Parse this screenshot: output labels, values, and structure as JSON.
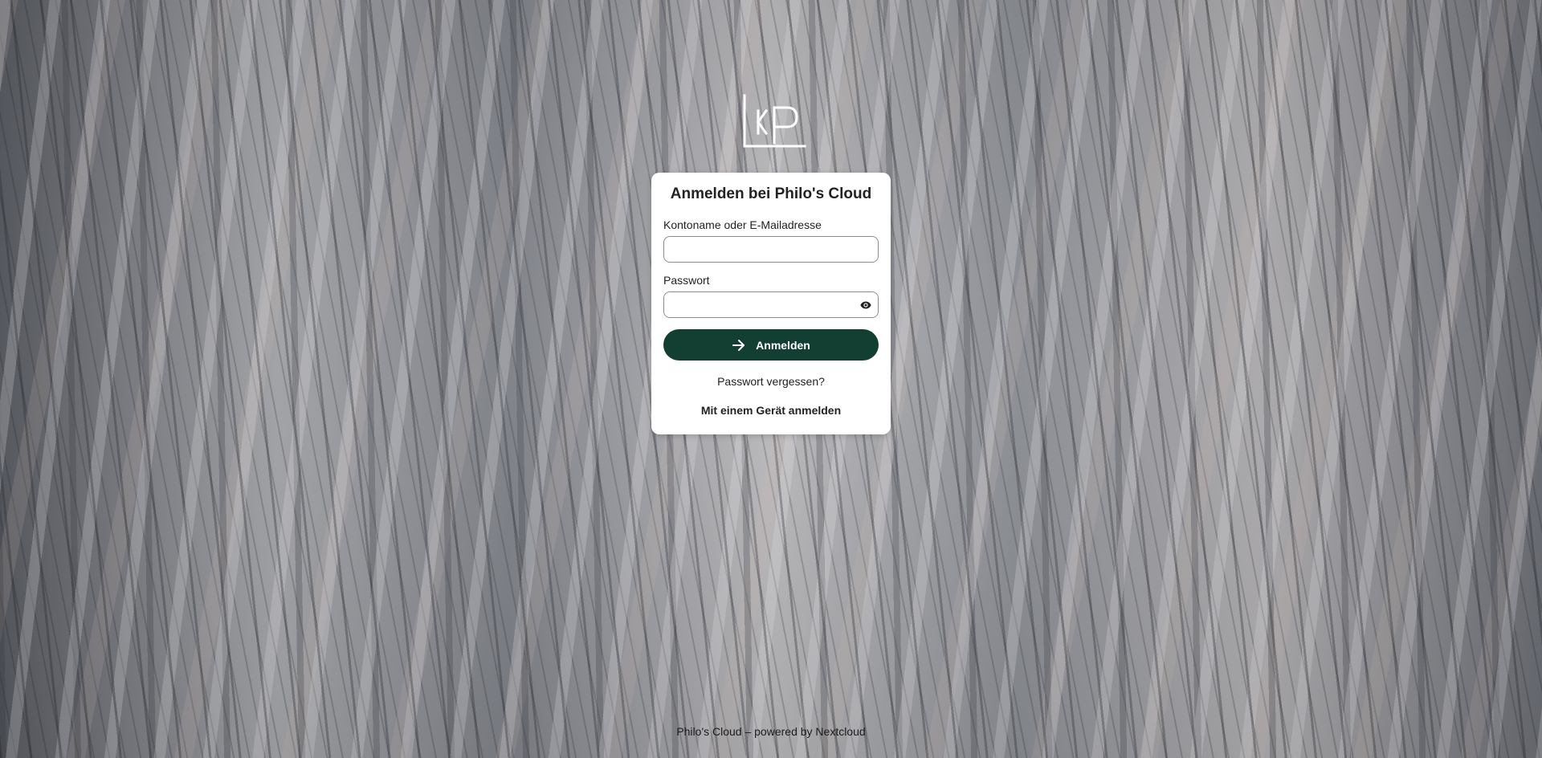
{
  "login": {
    "title": "Anmelden bei Philo's Cloud",
    "username_label": "Kontoname oder E-Mailadresse",
    "username_value": "",
    "password_label": "Passwort",
    "password_value": "",
    "submit_label": "Anmelden",
    "forgot_password_label": "Passwort vergessen?",
    "device_login_label": "Mit einem Gerät anmelden"
  },
  "footer": {
    "text": "Philo's Cloud – powered by Nextcloud"
  },
  "icons": {
    "logo": "lkp-logo",
    "password_toggle": "eye-icon",
    "submit": "arrow-right-icon"
  },
  "colors": {
    "primary": "#123f32",
    "card_background": "#ffffff"
  }
}
